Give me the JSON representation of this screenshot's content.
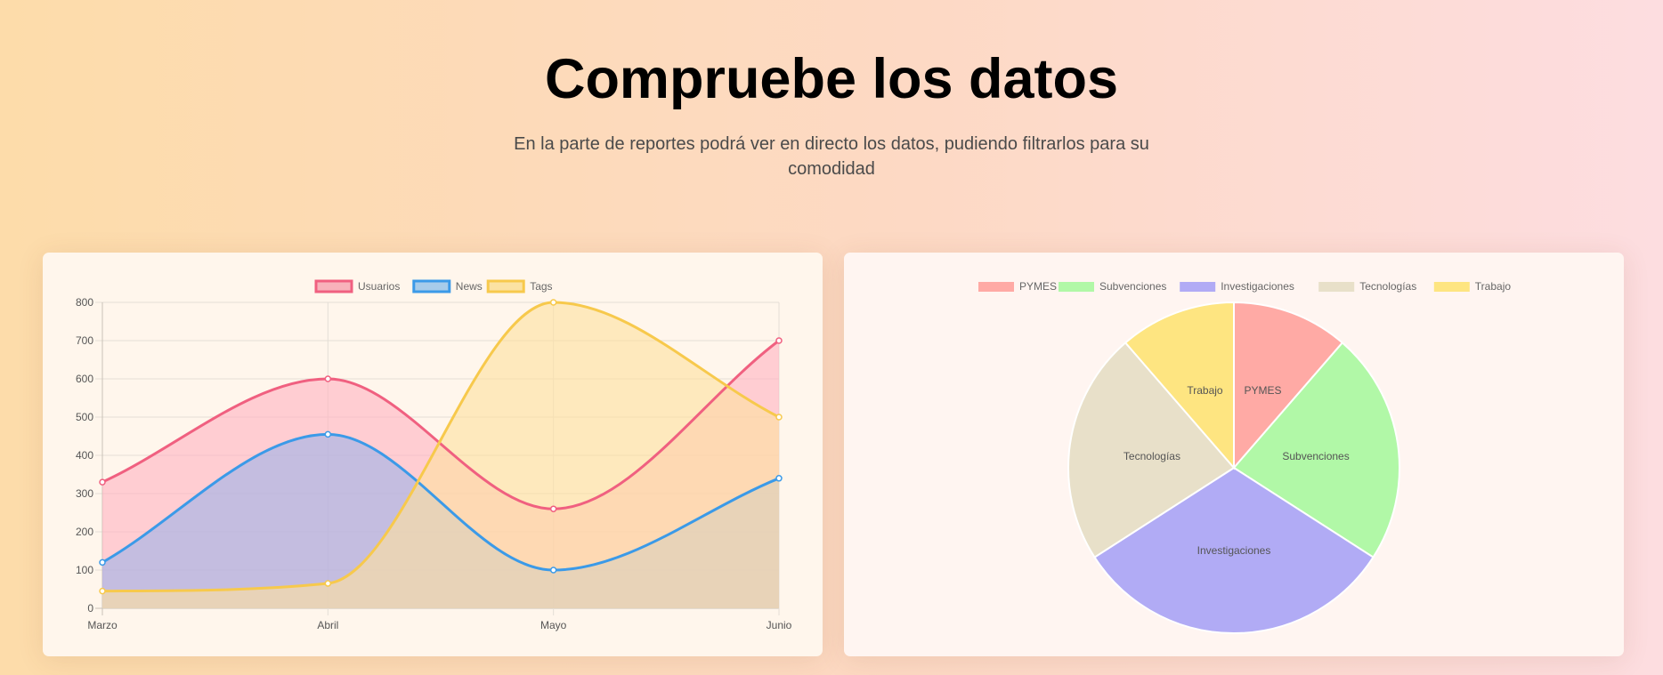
{
  "header": {
    "title": "Compruebe los datos",
    "subtitle": "En la parte de reportes podrá ver en directo los datos, pudiendo filtrarlos para su comodidad"
  },
  "chart_data": [
    {
      "type": "area",
      "categories": [
        "Marzo",
        "Abril",
        "Mayo",
        "Junio"
      ],
      "series": [
        {
          "name": "Usuarios",
          "values": [
            330,
            600,
            260,
            700
          ],
          "color": "#f06080",
          "fill": "#ffb3c1"
        },
        {
          "name": "News",
          "values": [
            120,
            455,
            100,
            340
          ],
          "color": "#3b9ae8",
          "fill": "#9fb3e8"
        },
        {
          "name": "Tags",
          "values": [
            45,
            65,
            800,
            500
          ],
          "color": "#f7c94c",
          "fill": "#fde1a0"
        }
      ],
      "y_ticks": [
        0,
        100,
        200,
        300,
        400,
        500,
        600,
        700,
        800
      ],
      "ylim": [
        0,
        800
      ],
      "grid": true,
      "legend": "top-center"
    },
    {
      "type": "pie",
      "labels": [
        "PYMES",
        "Subvenciones",
        "Investigaciones",
        "Tecnologías",
        "Trabajo"
      ],
      "values": [
        10,
        20,
        28,
        20,
        10
      ],
      "colors": [
        "#ffaaa5",
        "#b1f8a7",
        "#b1abf5",
        "#e8e0c9",
        "#fee581"
      ],
      "legend": "top-center"
    }
  ]
}
